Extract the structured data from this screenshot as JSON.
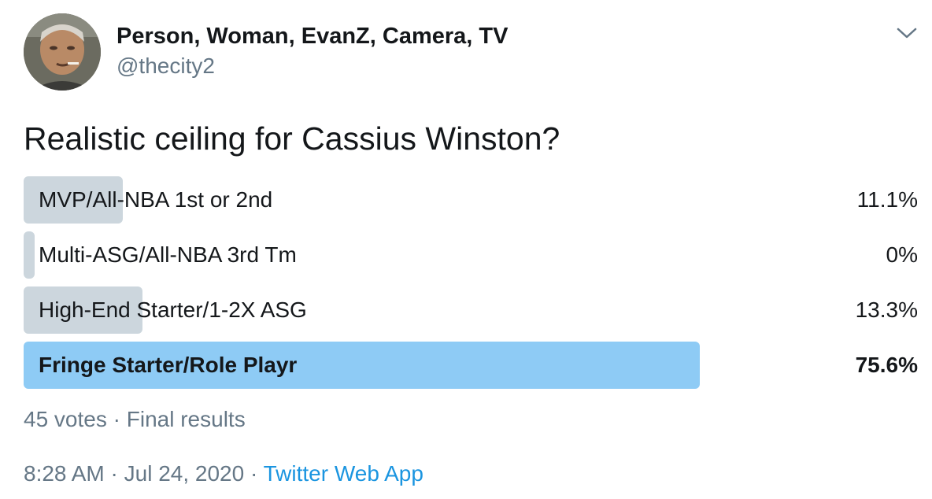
{
  "author": {
    "display_name": "Person, Woman, EvanZ, Camera, TV",
    "handle": "@thecity2"
  },
  "tweet": {
    "text": "Realistic ceiling for Cassius Winston?"
  },
  "poll": {
    "choices": [
      {
        "label": "MVP/All-NBA 1st or 2nd",
        "percent_text": "11.1%",
        "percent": 11.1,
        "winner": false
      },
      {
        "label": "Multi-ASG/All-NBA 3rd Tm",
        "percent_text": "0%",
        "percent": 0,
        "winner": false
      },
      {
        "label": "High-End Starter/1-2X ASG",
        "percent_text": "13.3%",
        "percent": 13.3,
        "winner": false
      },
      {
        "label": "Fringe Starter/Role Playr",
        "percent_text": "75.6%",
        "percent": 75.6,
        "winner": true
      }
    ],
    "votes": "45 votes",
    "separator": " · ",
    "status": "Final results"
  },
  "meta": {
    "time": "8:28 AM",
    "separator": " · ",
    "date": "Jul 24, 2020",
    "separator2": " · ",
    "source": "Twitter Web App"
  },
  "colors": {
    "bar": "#ccd6dd",
    "winner_bar": "#8ecbf5",
    "link": "#1b95e0",
    "secondary_text": "#657786"
  },
  "icons": {
    "avatar": "user-avatar-photo",
    "caret": "chevron-down-icon"
  }
}
